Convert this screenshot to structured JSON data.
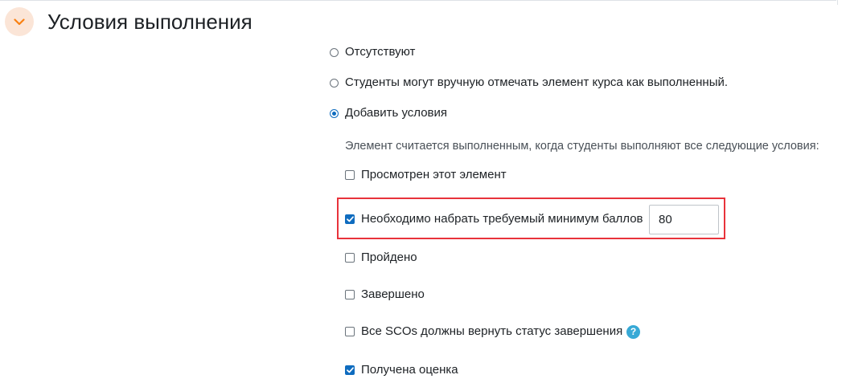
{
  "section": {
    "title": "Условия выполнения",
    "toggle_icon": "chevron-down-icon",
    "accent_color": "#f98012"
  },
  "radio_options": [
    {
      "label": "Отсутствуют",
      "selected": false
    },
    {
      "label": "Студенты могут вручную отмечать элемент курса как выполненный.",
      "selected": false
    },
    {
      "label": "Добавить условия",
      "selected": true
    }
  ],
  "conditions_description": "Элемент считается выполненным, когда студенты выполняют все следующие условия:",
  "conditions": [
    {
      "label": "Просмотрен этот элемент",
      "checked": false
    },
    {
      "label": "Необходимо набрать требуемый минимум баллов",
      "checked": true,
      "value": "80"
    },
    {
      "label": "Пройдено",
      "checked": false
    },
    {
      "label": "Завершено",
      "checked": false
    },
    {
      "label": "Все SCOs должны вернуть статус завершения",
      "checked": false,
      "help_icon": "question-circle-icon"
    },
    {
      "label": "Получена оценка",
      "checked": true
    }
  ],
  "colors": {
    "checkbox_checked": "#0f6cbf",
    "highlight_border": "#e8333b",
    "help_icon": "#37a9d6"
  }
}
